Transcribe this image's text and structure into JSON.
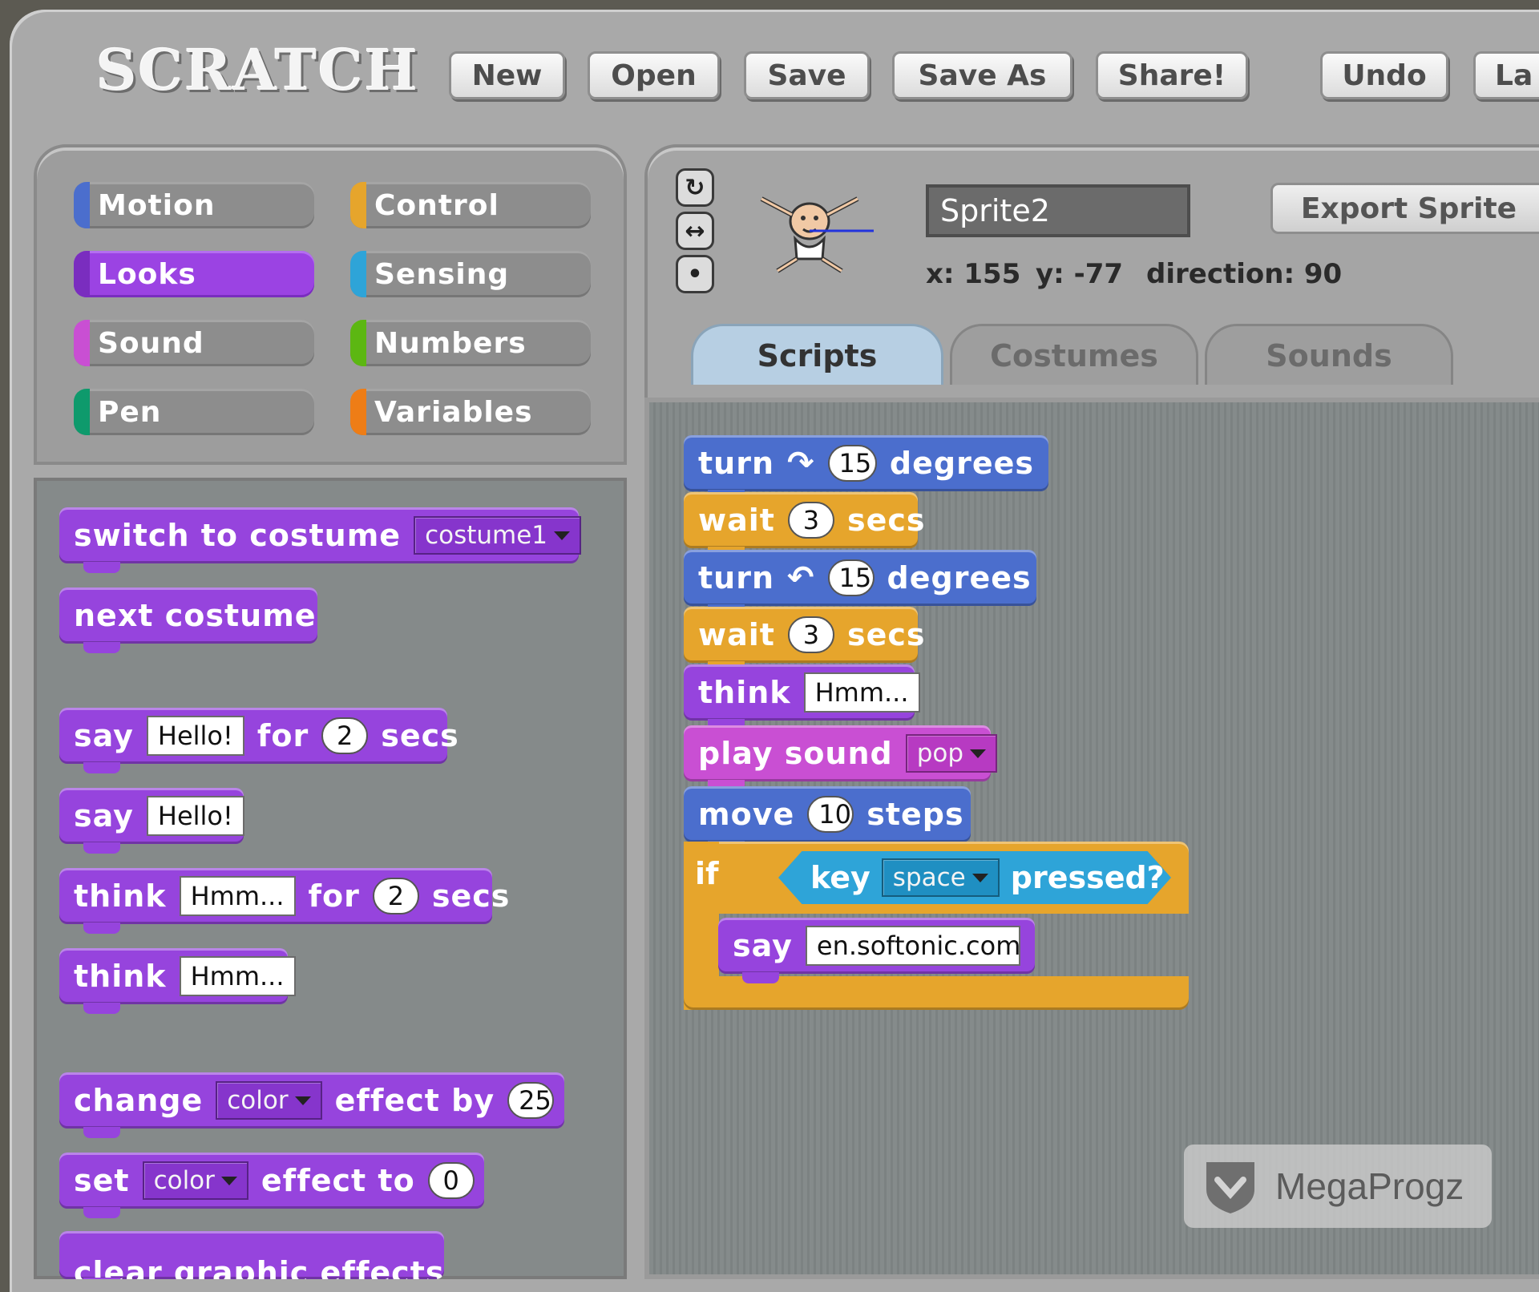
{
  "app": {
    "logo": "SCRATCH"
  },
  "toolbar": {
    "buttons": [
      "New",
      "Open",
      "Save",
      "Save As",
      "Share!",
      "Undo",
      "La"
    ]
  },
  "categories": [
    {
      "label": "Motion",
      "color": "#4b6ecd",
      "selected": false
    },
    {
      "label": "Control",
      "color": "#e6a52c",
      "selected": false
    },
    {
      "label": "Looks",
      "color": "#9644dd",
      "selected": true
    },
    {
      "label": "Sensing",
      "color": "#2ea4d8",
      "selected": false
    },
    {
      "label": "Sound",
      "color": "#c94fd3",
      "selected": false
    },
    {
      "label": "Numbers",
      "color": "#5cb712",
      "selected": false
    },
    {
      "label": "Pen",
      "color": "#0e9a6c",
      "selected": false
    },
    {
      "label": "Variables",
      "color": "#ee7d16",
      "selected": false
    }
  ],
  "palette": {
    "switch_costume": {
      "label": "switch to costume",
      "value": "costume1"
    },
    "next_costume": {
      "label": "next costume"
    },
    "say_for": {
      "say": "say",
      "text": "Hello!",
      "for": "for",
      "secs_value": "2",
      "secs": "secs"
    },
    "say": {
      "say": "say",
      "text": "Hello!"
    },
    "think_for": {
      "think": "think",
      "text": "Hmm...",
      "for": "for",
      "secs_value": "2",
      "secs": "secs"
    },
    "think": {
      "think": "think",
      "text": "Hmm..."
    },
    "change_effect": {
      "change": "change",
      "effect": "color",
      "by": "effect by",
      "value": "25"
    },
    "set_effect": {
      "set": "set",
      "effect": "color",
      "to": "effect to",
      "value": "0"
    },
    "clear_effects": {
      "label": "clear graphic effects"
    }
  },
  "sprite": {
    "name": "Sprite2",
    "export_label": "Export Sprite",
    "x_label": "x:",
    "x": "155",
    "y_label": "y:",
    "y": "-77",
    "direction_label": "direction:",
    "direction": "90"
  },
  "tabs": [
    {
      "label": "Scripts",
      "active": true
    },
    {
      "label": "Costumes",
      "active": false
    },
    {
      "label": "Sounds",
      "active": false
    }
  ],
  "script": {
    "turn_cw": {
      "turn": "turn",
      "value": "15",
      "degrees": "degrees"
    },
    "wait1": {
      "wait": "wait",
      "value": "3",
      "secs": "secs"
    },
    "turn_ccw": {
      "turn": "turn",
      "value": "15",
      "degrees": "degrees"
    },
    "wait2": {
      "wait": "wait",
      "value": "3",
      "secs": "secs"
    },
    "think": {
      "think": "think",
      "text": "Hmm..."
    },
    "play_sound": {
      "label": "play sound",
      "value": "pop"
    },
    "move": {
      "move": "move",
      "value": "10",
      "steps": "steps"
    },
    "if_block": {
      "if": "if",
      "key": "key",
      "key_value": "space",
      "pressed": "pressed?"
    },
    "say": {
      "say": "say",
      "text": "en.softonic.com"
    }
  },
  "watermark": {
    "text": "MegaProgz"
  }
}
